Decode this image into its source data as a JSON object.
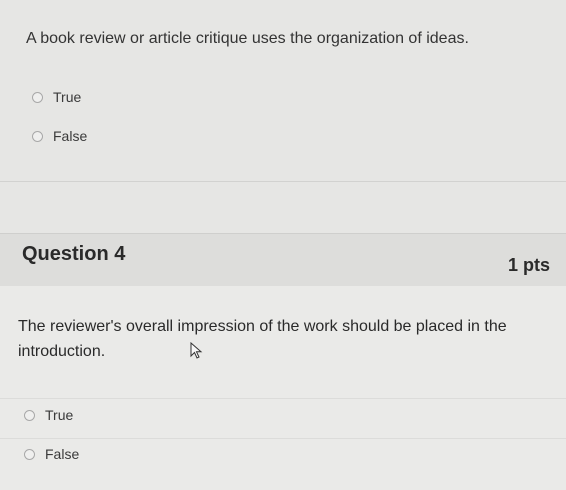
{
  "question3": {
    "text": "A book review or article critique uses the organization of ideas.",
    "options": [
      "True",
      "False"
    ]
  },
  "question4": {
    "title": "Question 4",
    "points": "1 pts",
    "text": "The reviewer's overall impression of the work should be placed in the introduction.",
    "options": [
      "True",
      "False"
    ]
  }
}
